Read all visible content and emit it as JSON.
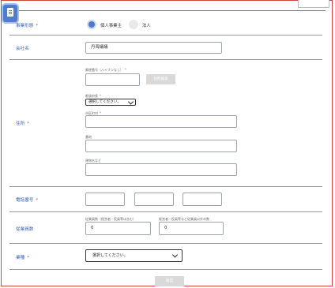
{
  "form": {
    "business_type": {
      "label": "事業形態",
      "required_mark": "*",
      "options": [
        {
          "label": "個人事業主",
          "selected": true
        },
        {
          "label": "法人",
          "selected": false
        }
      ]
    },
    "company_name": {
      "label": "会社名",
      "value": "丹海議議"
    },
    "address": {
      "label": "住所",
      "required_mark": "*",
      "postal_code_label": "郵便番号（ハイフンなし）",
      "postal_code_required": "*",
      "postal_search_button": "住所検索",
      "prefecture_label": "都道府県",
      "prefecture_required": "*",
      "prefecture_value": "選択してください。",
      "city_label": "市区町村",
      "city_required": "*",
      "street_label": "番地",
      "building_label": "建物名など"
    },
    "phone": {
      "label": "電話番号",
      "required_mark": "*"
    },
    "employees": {
      "label": "従業員数",
      "excluding_label": "従業員数（経営者・役員等は含む）",
      "excluding_value": "0",
      "including_label": "経営者・役員等など従業員以外の数",
      "including_value": "0"
    },
    "industry": {
      "label": "業種",
      "required_mark": "*",
      "value": "選択してください。"
    },
    "submit_label": "確認"
  },
  "colors": {
    "label_blue": "#3a63b8",
    "required_red": "#d64040",
    "radio_selected": "#4d79c9",
    "frame_border": "#d0453c"
  }
}
